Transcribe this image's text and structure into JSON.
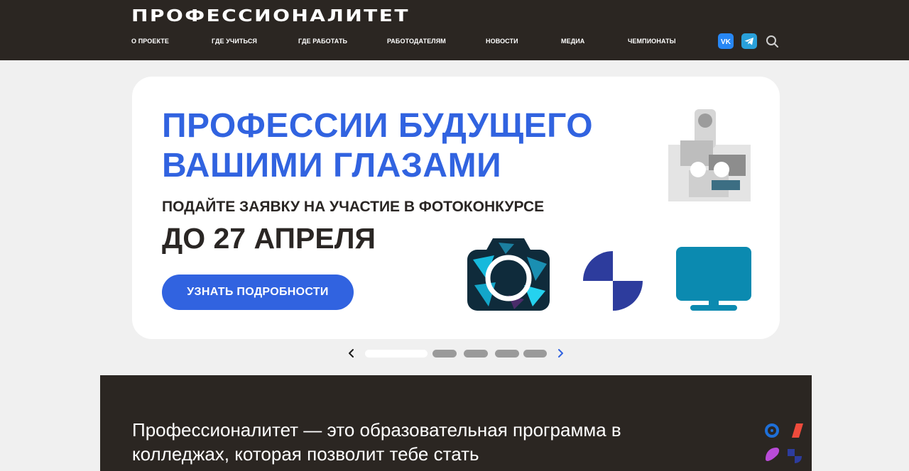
{
  "header": {
    "logo": "ПРОФЕССИОНАЛИТЕТ",
    "nav": [
      {
        "label": "О ПРОЕКТЕ"
      },
      {
        "label": "ГДЕ УЧИТЬСЯ"
      },
      {
        "label": "ГДЕ РАБОТАТЬ"
      },
      {
        "label": "РАБОТОДАТЕЛЯМ"
      },
      {
        "label": "НОВОСТИ"
      },
      {
        "label": "МЕДИА"
      },
      {
        "label": "ЧЕМПИОНАТЫ"
      }
    ],
    "social": [
      {
        "icon": "vk-icon",
        "text": "VK"
      },
      {
        "icon": "telegram-icon"
      }
    ],
    "search_icon": "search-icon"
  },
  "banner": {
    "title": "ПРОФЕССИИ БУДУЩЕГО ВАШИМИ ГЛАЗАМИ",
    "subtitle": "ПОДАЙТЕ ЗАЯВКУ НА УЧАСТИЕ В ФОТОКОНКУРСЕ",
    "deadline": "ДО 27 АПРЕЛЯ",
    "button": "УЗНАТЬ ПОДРОБНОСТИ",
    "images": [
      "robot-photo",
      "camera-icon",
      "half-circles-logo",
      "monitor-icon"
    ]
  },
  "slider": {
    "slides": 5,
    "active_index": 0,
    "prev_icon": "chevron-left-icon",
    "next_icon": "chevron-right-icon"
  },
  "about": {
    "text": "Профессионалитет — это образовательная программа в колледжах, которая позволит тебе стать"
  },
  "colors": {
    "header_bg": "#2b2622",
    "accent": "#3163e0",
    "page_bg": "#f0f0f0",
    "monitor": "#0b8ab0"
  }
}
